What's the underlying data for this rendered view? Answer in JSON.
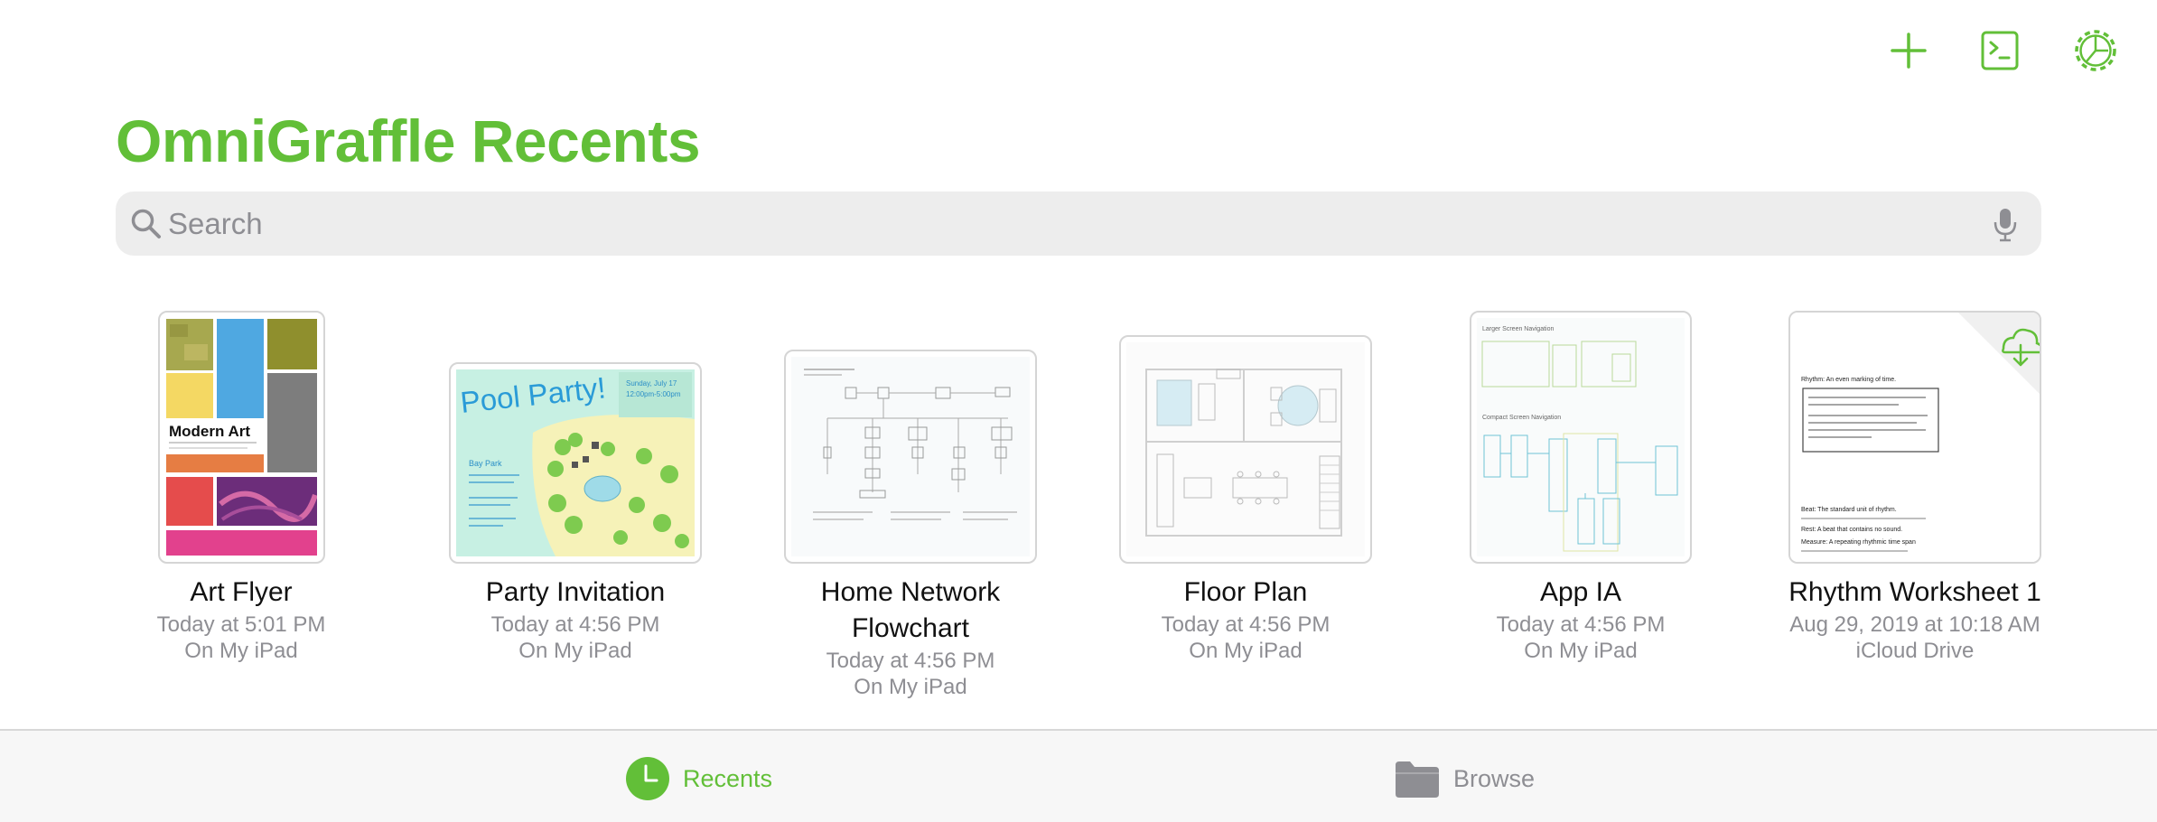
{
  "app": {
    "title": "OmniGraffle Recents"
  },
  "toolbar": {
    "add_icon": "plus-icon",
    "terminal_icon": "terminal-icon",
    "settings_icon": "gear-icon",
    "accent_color": "#62bf38"
  },
  "search": {
    "placeholder": "Search"
  },
  "documents": [
    {
      "title_lines": [
        "Art Flyer"
      ],
      "date": "Today at 5:01 PM",
      "location": "On My iPad",
      "thumb": {
        "heading": "Modern Art"
      }
    },
    {
      "title_lines": [
        "Party Invitation"
      ],
      "date": "Today at 4:56 PM",
      "location": "On My iPad",
      "thumb": {
        "heading": "Pool Party!",
        "date_line": "Sunday, July 17",
        "time_line": "12:00pm-5:00pm",
        "place": "Bay Park"
      }
    },
    {
      "title_lines": [
        "Home Network",
        "Flowchart"
      ],
      "date": "Today at 4:56 PM",
      "location": "On My iPad"
    },
    {
      "title_lines": [
        "Floor Plan"
      ],
      "date": "Today at 4:56 PM",
      "location": "On My iPad"
    },
    {
      "title_lines": [
        "App IA"
      ],
      "date": "Today at 4:56 PM",
      "location": "On My iPad",
      "thumb": {
        "section1": "Larger Screen Navigation",
        "section2": "Compact Screen Navigation"
      }
    },
    {
      "title_lines": [
        "Rhythm Worksheet 1"
      ],
      "date": "Aug 29, 2019 at 10:18 AM",
      "location": "iCloud Drive",
      "thumb": {
        "line1": "Rhythm: An even marking of time.",
        "line2": "Beat: The standard unit of rhythm.",
        "line3": "Rest: A beat that contains no sound.",
        "line4": "Measure: A repeating rhythmic time span"
      }
    }
  ],
  "tabs": [
    {
      "label": "Recents",
      "icon": "clock-icon",
      "selected": true
    },
    {
      "label": "Browse",
      "icon": "folder-icon",
      "selected": false
    }
  ]
}
